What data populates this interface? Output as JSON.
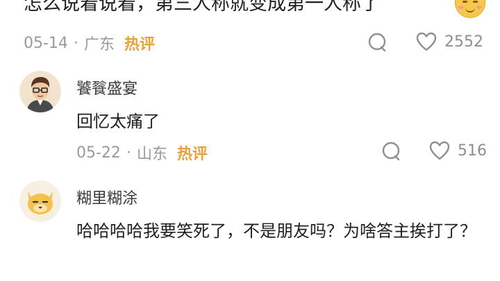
{
  "top_comment": {
    "text": "怎么说着说着，第三人称就变成第一人称了",
    "date": "05-14",
    "location": "广东",
    "hot_label": "热评",
    "like_count": "2552"
  },
  "replies": [
    {
      "username": "饕餮盛宴",
      "text": "回忆太痛了",
      "date": "05-22",
      "location": "山东",
      "hot_label": "热评",
      "like_count": "516"
    },
    {
      "username": "糊里糊涂",
      "text": "哈哈哈哈我要笑死了，不是朋友吗？为啥答主挨打了？"
    }
  ],
  "separator": "·",
  "icons": {
    "comment": "comment-bubble-icon",
    "like": "heart-outline-icon",
    "emoji": "smiling-face-emoji"
  }
}
